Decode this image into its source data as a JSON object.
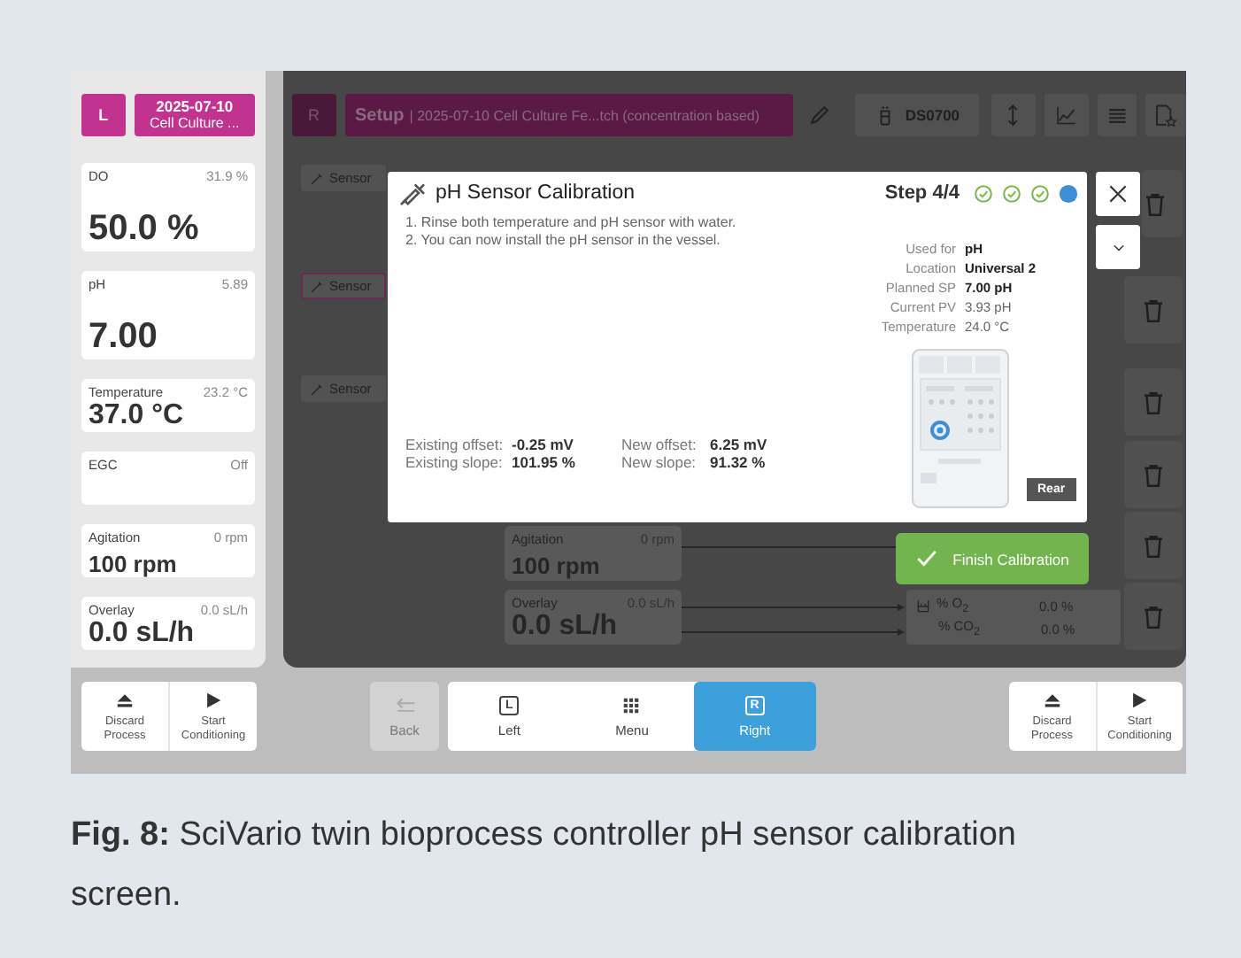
{
  "left_panel": {
    "side_label": "L",
    "run_button": {
      "date": "2025-07-10",
      "name": "Cell Culture ..."
    },
    "cards": [
      {
        "label": "DO",
        "reading": "31.9 %",
        "value": "50.0 %",
        "kind": "tall"
      },
      {
        "label": "pH",
        "reading": "5.89",
        "value": "7.00",
        "kind": "tall"
      },
      {
        "label": "Temperature",
        "reading": "23.2 °C",
        "value": "37.0 °C",
        "kind": "large"
      },
      {
        "label": "EGC",
        "reading": "Off",
        "kind": "blank"
      },
      {
        "label": "Agitation",
        "reading": "0 rpm",
        "value": "100 rpm",
        "kind": "medium"
      },
      {
        "label": "Overlay",
        "reading": "0.0 sL/h",
        "value": "0.0 sL/h",
        "kind": "large"
      }
    ]
  },
  "right_panel": {
    "side_label": "R",
    "title": "Setup",
    "subtitle": "| 2025-07-10 Cell Culture Fe...tch (concentration based)",
    "device": "DS0700",
    "sensor_chips": [
      {
        "label": "Sensor",
        "selected": false
      },
      {
        "label": "Sensor",
        "selected": true
      },
      {
        "label": "Sensor",
        "selected": false
      }
    ],
    "cards": [
      {
        "label": "Agitation",
        "reading": "0 rpm",
        "value": "100 rpm",
        "kind": "medium"
      },
      {
        "label": "Overlay",
        "reading": "0.0 sL/h",
        "value": "0.0 sL/h",
        "kind": "large"
      }
    ],
    "gases": [
      {
        "label": "% O$_{2}$",
        "reading": "0.0 %"
      },
      {
        "label": "% CO$_{2}$",
        "reading": "0.0 %"
      }
    ]
  },
  "modal": {
    "title": "pH Sensor Calibration",
    "step": "Step 4/4",
    "steps": [
      {
        "done": true
      },
      {
        "done": true
      },
      {
        "done": true
      },
      {
        "done": false
      }
    ],
    "instructions": [
      "1. Rinse both temperature and pH sensor with water.",
      "2. You can now install the pH sensor in the vessel."
    ],
    "details": [
      {
        "label": "Used for",
        "value": "pH",
        "emphasized": true
      },
      {
        "label": "Location",
        "value": "Universal 2",
        "emphasized": true
      },
      {
        "label": "Planned SP",
        "value": "7.00 pH",
        "emphasized": true
      },
      {
        "label": "Current PV",
        "value": "3.93 pH",
        "emphasized": false
      },
      {
        "label": "Temperature",
        "value": "24.0 °C",
        "emphasized": false
      }
    ],
    "offsets": [
      {
        "label": "Existing offset:",
        "value": "-0.25 mV"
      },
      {
        "label": "New offset:",
        "value": "6.25 mV"
      },
      {
        "label": "Existing slope:",
        "value": "101.95 %"
      },
      {
        "label": "New slope:",
        "value": "91.32 %"
      }
    ],
    "view_label": "Rear"
  },
  "finish_button": "Finish Calibration",
  "bottom_bar": {
    "left_actions": [
      {
        "label": "Discard Process",
        "kind": "eject"
      },
      {
        "label": "Start Conditioning",
        "kind": "play"
      }
    ],
    "nav": [
      {
        "label": "Back",
        "kind": "back",
        "disabled": true,
        "selected": false
      },
      {
        "label": "Left",
        "kind": "key",
        "key": "L",
        "disabled": false,
        "selected": false
      },
      {
        "label": "Menu",
        "kind": "grid",
        "disabled": false,
        "selected": false
      },
      {
        "label": "Right",
        "kind": "key",
        "key": "R",
        "disabled": false,
        "selected": true
      }
    ],
    "right_actions": [
      {
        "label": "Discard Process",
        "kind": "eject"
      },
      {
        "label": "Start Conditioning",
        "kind": "play"
      }
    ]
  },
  "caption": "**Fig. 8:** SciVario twin bioprocess controller pH sensor calibration screen."
}
